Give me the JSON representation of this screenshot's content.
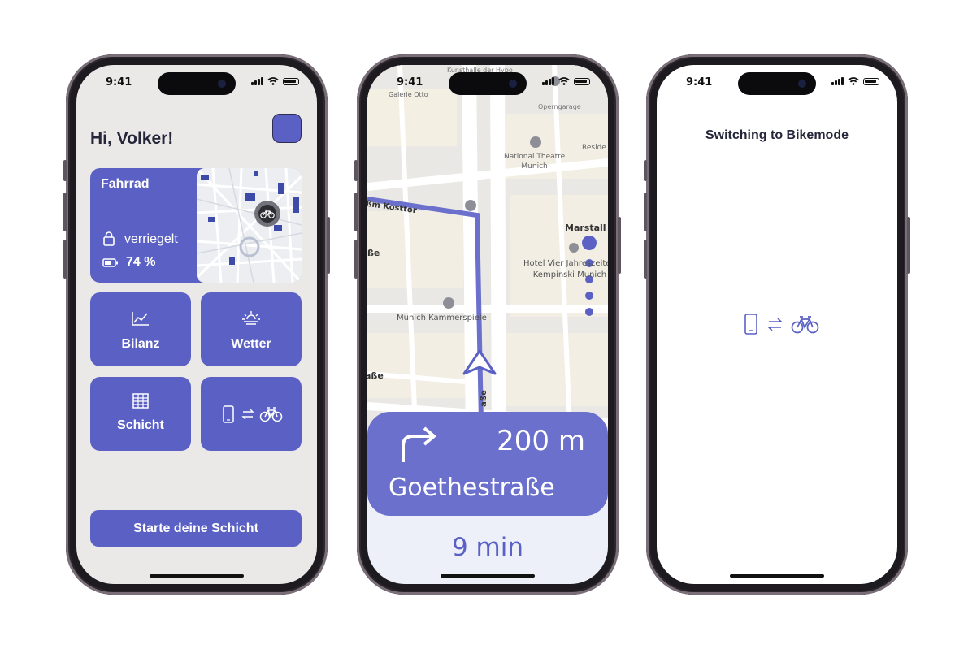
{
  "colors": {
    "accent": "#5b61c4",
    "app_bg": "#ebe9e7",
    "route": "#6b70cc"
  },
  "status": {
    "time": "9:41"
  },
  "screen1": {
    "greeting": "Hi, Volker!",
    "bike_card": {
      "title": "Fahrrad",
      "lock_status": "verriegelt",
      "battery": "74 %"
    },
    "tiles": [
      {
        "label": "Bilanz",
        "icon": "chart-icon"
      },
      {
        "label": "Wetter",
        "icon": "sun-cloud-icon"
      },
      {
        "label": "Schicht",
        "icon": "table-icon"
      },
      {
        "label": "",
        "icon": "phone-bike-switch-icon"
      }
    ],
    "start_button": "Starte deine Schicht"
  },
  "screen2": {
    "map_labels": {
      "top": "Kunsthalle der Hypo",
      "galerie": "Galerie Otto",
      "opern": "Operngarage",
      "theatre1": "National Theatre",
      "theatre2": "Munich",
      "resid": "Reside",
      "marstall": "Marstall",
      "hotel1": "Hotel Vier Jahreszeiten",
      "hotel2": "Kempinski Munich",
      "kammer": "Munich Kammerspiele",
      "street_left": "ßm Kosttor",
      "street_left2": "ße",
      "street_left3": "aße",
      "street_vertical": "aße"
    },
    "instruction": {
      "distance": "200 m",
      "street": "Goethestraße",
      "eta": "9 min"
    }
  },
  "screen3": {
    "title": "Switching to Bikemode"
  }
}
